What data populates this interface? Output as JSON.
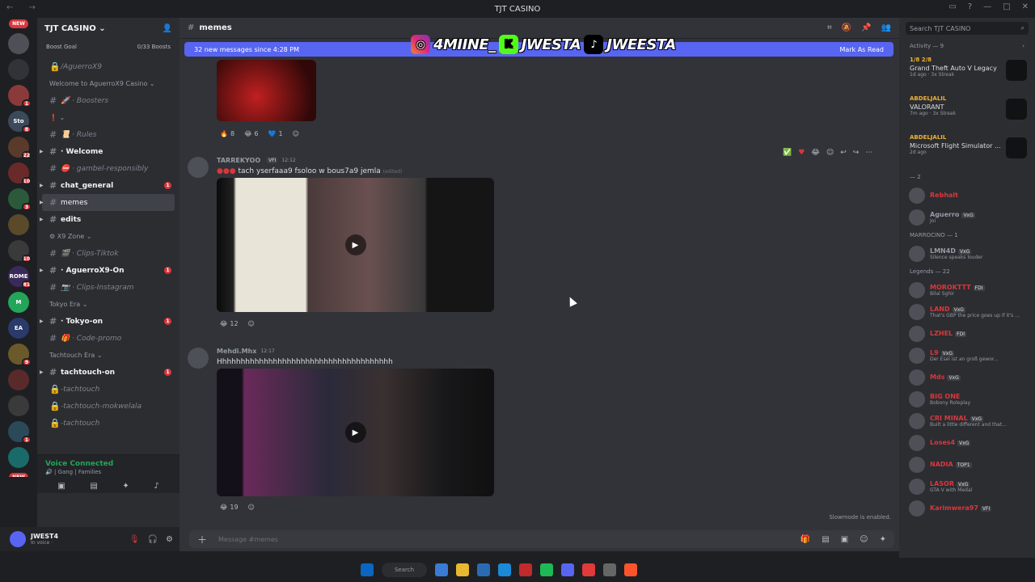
{
  "window": {
    "title": "TJT CASINO",
    "nav_icon": "back-forward-arrows",
    "controls": [
      "inbox-icon",
      "help-icon",
      "minimize",
      "maximize",
      "close"
    ]
  },
  "colors": {
    "blurple": "#5865f2",
    "red": "#da373c",
    "green": "#23a55a",
    "gold": "#f0b232",
    "bg_main": "#313338",
    "bg_sidebar": "#2b2d31"
  },
  "guilds": {
    "new_label": "NEW",
    "items": [
      {
        "label": "",
        "badge": "",
        "color": "#4e5058"
      },
      {
        "label": "",
        "badge": "",
        "color": "#313338"
      },
      {
        "label": "",
        "badge": "1",
        "color": "#8b3a3a"
      },
      {
        "label": "Sto",
        "badge": "8",
        "color": "#3a4a5a"
      },
      {
        "label": "",
        "badge": "22",
        "color": "#5a3a2a"
      },
      {
        "label": "",
        "badge": "10",
        "color": "#6a2a2a"
      },
      {
        "label": "",
        "badge": "3",
        "color": "#2a5a3a"
      },
      {
        "label": "",
        "badge": "",
        "color": "#5a4a2a"
      },
      {
        "label": "",
        "badge": "10",
        "color": "#3a3a3a"
      },
      {
        "label": "ROME",
        "badge": "81",
        "color": "#3a2a5a"
      },
      {
        "label": "M",
        "badge": "",
        "color": "#23a55a"
      },
      {
        "label": "EA",
        "badge": "",
        "color": "#2a3a6a"
      },
      {
        "label": "",
        "badge": "9",
        "color": "#6a5a2a"
      },
      {
        "label": "",
        "badge": "",
        "color": "#5a2a2a"
      },
      {
        "label": "",
        "badge": "",
        "color": "#3a3a3a"
      },
      {
        "label": "",
        "badge": "1",
        "color": "#2a4a5a"
      },
      {
        "label": "",
        "badge": "",
        "color": "#1a6a6a"
      }
    ]
  },
  "server": {
    "name": "TJT CASINO",
    "boost_goal": "Boost Goal",
    "boost_count": "0/33 Boosts"
  },
  "channel_list": [
    {
      "kind": "ch",
      "label": "/AguerroX9",
      "icon": "🔒",
      "style": "dim"
    },
    {
      "kind": "cat",
      "label": "Welcome to AguerroX9 Casino ⌄"
    },
    {
      "kind": "ch",
      "label": "🚀 · Boosters",
      "icon": "#",
      "style": "dim"
    },
    {
      "kind": "cat",
      "label": "❗ ⌄"
    },
    {
      "kind": "ch",
      "label": "📜 · Rules",
      "icon": "#",
      "style": "dim"
    },
    {
      "kind": "ch",
      "label": "· Welcome",
      "icon": "#",
      "style": "bright",
      "arrow": true
    },
    {
      "kind": "ch",
      "label": "⛔ · gambel-responsibly",
      "icon": "#",
      "style": "dim"
    },
    {
      "kind": "ch",
      "label": "chat_general",
      "icon": "#",
      "style": "bright",
      "arrow": true,
      "unread": "1"
    },
    {
      "kind": "ch",
      "label": "memes",
      "icon": "#",
      "style": "active",
      "arrow": true
    },
    {
      "kind": "ch",
      "label": "edits",
      "icon": "#",
      "style": "bright",
      "arrow": true
    },
    {
      "kind": "cat",
      "label": "⚙ X9 Zone ⌄"
    },
    {
      "kind": "ch",
      "label": "🎬 · Clips-Tiktok",
      "icon": "#",
      "style": "dim"
    },
    {
      "kind": "ch",
      "label": "· AguerroX9-On",
      "icon": "#",
      "style": "bright",
      "arrow": true,
      "unread": "1"
    },
    {
      "kind": "ch",
      "label": "📷 · Clips-Instagram",
      "icon": "#",
      "style": "dim"
    },
    {
      "kind": "cat",
      "label": "Tokyo Era ⌄"
    },
    {
      "kind": "ch",
      "label": "· Tokyo-on",
      "icon": "#",
      "style": "bright",
      "arrow": true,
      "unread": "1"
    },
    {
      "kind": "ch",
      "label": "🎁 · Code-promo",
      "icon": "#",
      "style": "dim"
    },
    {
      "kind": "cat",
      "label": "Tachtouch Era ⌄"
    },
    {
      "kind": "ch",
      "label": "tachtouch-on",
      "icon": "#",
      "style": "bright",
      "arrow": true,
      "unread": "1"
    },
    {
      "kind": "ch",
      "label": "-tachtouch",
      "icon": "🔒",
      "style": "dim"
    },
    {
      "kind": "ch",
      "label": "-tachtouch-mokwelala",
      "icon": "🔒",
      "style": "dim"
    },
    {
      "kind": "ch",
      "label": "-tachtouch",
      "icon": "🔒",
      "style": "dim"
    }
  ],
  "voice": {
    "status": "Voice Connected",
    "channel": "🔊 | Gang | Families"
  },
  "user": {
    "name": "JWEST4",
    "status": "In voice ·"
  },
  "header": {
    "channel": "memes",
    "new_messages": "32 new messages since 4:28 PM",
    "mark_read": "Mark As Read"
  },
  "socials": {
    "instagram": "4MIINE_",
    "kick": "JWESTA",
    "tiktok": "JWEESTA"
  },
  "messages": {
    "m1_reactions": [
      {
        "emoji": "🔥",
        "count": "8"
      },
      {
        "emoji": "😂",
        "count": "6"
      },
      {
        "emoji": "💙",
        "count": "1"
      },
      {
        "emoji": "☺",
        "count": ""
      }
    ],
    "m2": {
      "author": "TARREKYOO",
      "tag": "VFI",
      "time": "12:12",
      "text": "tach yserfaaa9 fsoloo w bous7a9 jemla",
      "edited": "(edited)",
      "reactions": [
        {
          "emoji": "😂",
          "count": "12"
        },
        {
          "emoji": "☺",
          "count": ""
        }
      ]
    },
    "m3": {
      "author": "Mehdi.Mhx",
      "time": "12:17",
      "text": "Hhhhhhhhhhhhhhhhhhhhhhhhhhhhhhhhhhhhhh",
      "reactions": [
        {
          "emoji": "😂",
          "count": "19"
        },
        {
          "emoji": "☺",
          "count": ""
        }
      ]
    }
  },
  "composer": {
    "placeholder": "Message #memes",
    "slowmode": "Slowmode is enabled."
  },
  "members": {
    "search_placeholder": "Search TJT CASINO",
    "activity_header": "Activity — 9",
    "activities": [
      {
        "name": "1/8 2/8",
        "game": "Grand Theft Auto V Legacy",
        "time": "1d ago · 3x Streak"
      },
      {
        "name": "ABDELJALIL",
        "game": "VALORANT",
        "time": "7m ago · 3x Streak"
      },
      {
        "name": "ABDELJALIL",
        "game": "Microsoft Flight Simulator ...",
        "time": "2d ago"
      }
    ],
    "groups": [
      {
        "title": "— 2",
        "items": [
          {
            "name": "Rebhalt",
            "tag": "",
            "status": "",
            "color": "#da373c"
          },
          {
            "name": "Aguerro",
            "tag": "VxG",
            "status": "Joi",
            "color": "#949ba4"
          }
        ]
      },
      {
        "title": "MARROCINO — 1",
        "items": [
          {
            "name": "LMN4D",
            "tag": "VxG",
            "status": "Silence speaks louder",
            "color": "#949ba4"
          }
        ]
      },
      {
        "title": "Legends — 22",
        "items": [
          {
            "name": "MOROKTTT",
            "tag": "FDI",
            "status": "Bilal Sghir",
            "color": "#da373c"
          },
          {
            "name": "LAND",
            "tag": "VxG",
            "status": "That's GBP the price goes up if it's ...",
            "color": "#da373c"
          },
          {
            "name": "LZHEL",
            "tag": "FDI",
            "status": "",
            "color": "#da373c"
          },
          {
            "name": "L9",
            "tag": "VxG",
            "status": "Der Esel ist an groß gewor...",
            "color": "#da373c"
          },
          {
            "name": "Mds",
            "tag": "VxG",
            "status": "",
            "color": "#da373c"
          },
          {
            "name": "BIG ONE",
            "tag": "",
            "status": "Bobony Roleplay",
            "color": "#da373c"
          },
          {
            "name": "CRI MINAL",
            "tag": "VxG",
            "status": "Built a little different and that...",
            "color": "#da373c"
          },
          {
            "name": "Loses4",
            "tag": "VxG",
            "status": "",
            "color": "#da373c"
          },
          {
            "name": "NADIA",
            "tag": "TOP1",
            "status": "",
            "color": "#da373c"
          },
          {
            "name": "LASOR",
            "tag": "VxG",
            "status": "GTA V with Medal",
            "color": "#da373c"
          },
          {
            "name": "Karimwera97",
            "tag": "VFI",
            "status": "",
            "color": "#da373c"
          }
        ]
      }
    ]
  },
  "taskbar": {
    "search": "Search"
  }
}
